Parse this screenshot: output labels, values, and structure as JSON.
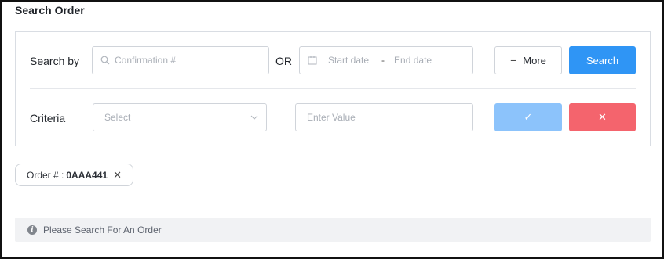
{
  "page": {
    "title": "Search Order"
  },
  "search_row": {
    "label": "Search by",
    "confirmation_placeholder": "Confirmation #",
    "or_text": "OR",
    "start_date_placeholder": "Start date",
    "date_separator": "-",
    "end_date_placeholder": "End date",
    "more_label": "More",
    "more_icon": "−",
    "search_label": "Search"
  },
  "criteria_row": {
    "label": "Criteria",
    "select_placeholder": "Select",
    "value_placeholder": "Enter Value",
    "confirm_icon": "✓",
    "cancel_icon": "✕"
  },
  "filter_tag": {
    "label": "Order # :",
    "value": "0AAA441",
    "remove_icon": "✕"
  },
  "notice": {
    "icon": "i",
    "text": "Please Search For An Order"
  },
  "colors": {
    "primary": "#2f95f5",
    "primary_light": "#8cc3fb",
    "danger": "#f4646d",
    "notice_bg": "#f1f2f4"
  }
}
